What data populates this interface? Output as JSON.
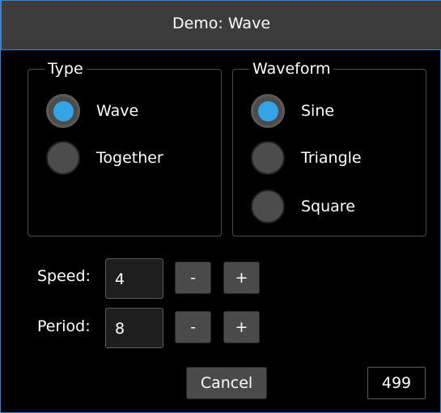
{
  "window": {
    "title": "Demo: Wave"
  },
  "type_group": {
    "legend": "Type",
    "options": [
      {
        "label": "Wave",
        "checked": true
      },
      {
        "label": "Together",
        "checked": false
      }
    ]
  },
  "waveform_group": {
    "legend": "Waveform",
    "options": [
      {
        "label": "Sine",
        "checked": true
      },
      {
        "label": "Triangle",
        "checked": false
      },
      {
        "label": "Square",
        "checked": false
      }
    ]
  },
  "speed": {
    "label": "Speed:",
    "value": "4",
    "minus": "-",
    "plus": "+"
  },
  "period": {
    "label": "Period:",
    "value": "8",
    "minus": "-",
    "plus": "+"
  },
  "footer": {
    "cancel_label": "Cancel",
    "counter": "499"
  },
  "colors": {
    "accent": "#33a5e6",
    "titlebar": "#3c3c3c",
    "window_border": "#3c82c8"
  }
}
